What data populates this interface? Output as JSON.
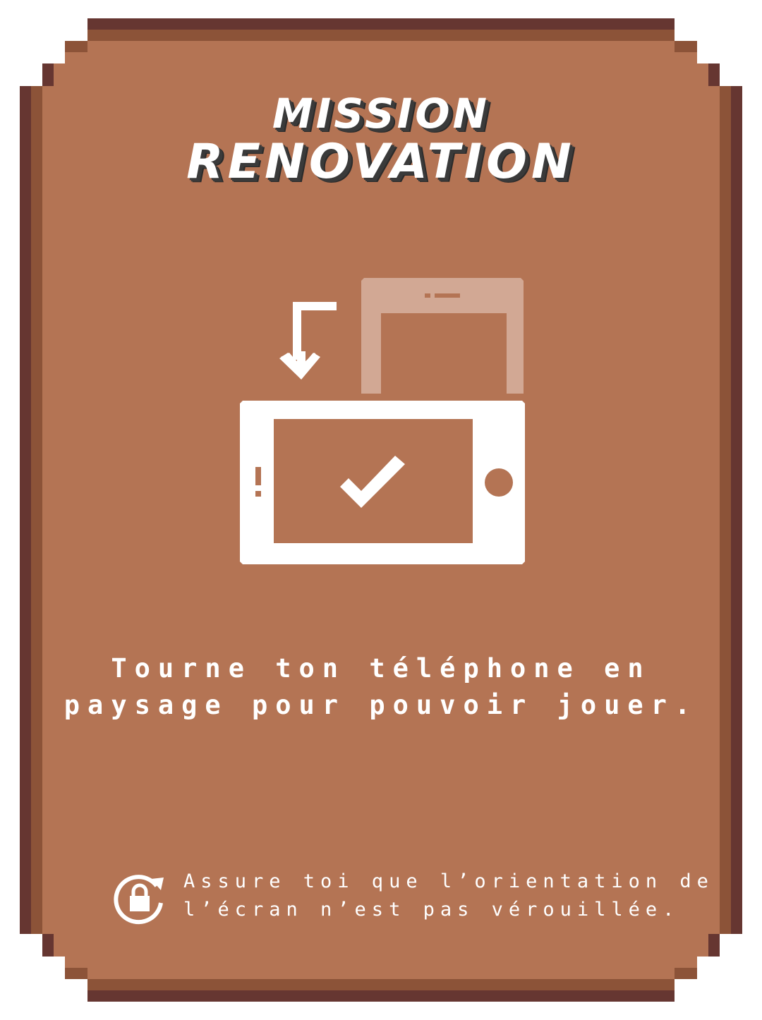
{
  "title": {
    "line1": "MISSION",
    "line2": "RENOVATION"
  },
  "message": {
    "line1": "Tourne ton téléphone en",
    "line2": "paysage pour pouvoir jouer."
  },
  "hint": {
    "icon": "rotation-lock-icon",
    "line1": "Assure toi que l’orientation de",
    "line2": "l’écran n’est pas vérouillée."
  },
  "colors": {
    "panel": "#b47454",
    "border_dark": "#663631",
    "border_mid": "#8c5338",
    "foreground": "#ffffff",
    "ghost_phone": "#d2a894"
  }
}
